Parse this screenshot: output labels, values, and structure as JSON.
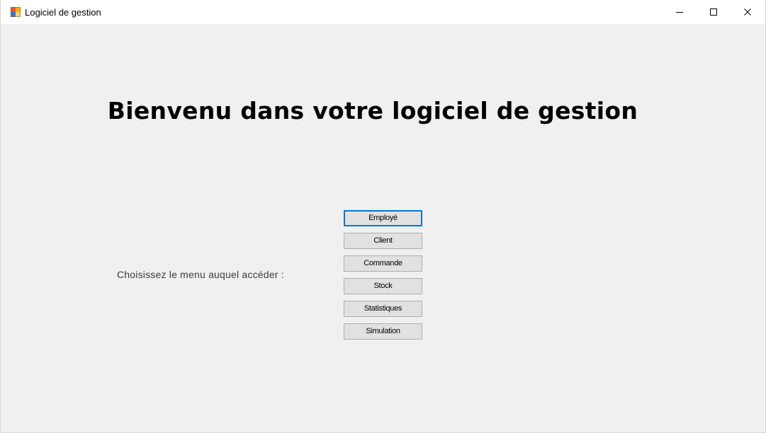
{
  "window": {
    "title": "Logiciel de gestion",
    "icon": "winforms-app-icon",
    "controls": [
      "minimize-icon",
      "maximize-icon",
      "close-icon"
    ]
  },
  "main": {
    "heading": "Bienvenu dans votre logiciel de gestion",
    "prompt": "Choisissez le menu auquel accéder :",
    "buttons": [
      {
        "label": "Employé",
        "focused": true
      },
      {
        "label": "Client"
      },
      {
        "label": "Commande"
      },
      {
        "label": "Stock"
      },
      {
        "label": "Statistiques"
      },
      {
        "label": "Simulation"
      }
    ]
  },
  "colors": {
    "background": "#f0f0f0",
    "titlebar": "#ffffff",
    "button_face": "#e1e1e1",
    "button_border": "#adadad",
    "focus_border": "#0078d7"
  }
}
